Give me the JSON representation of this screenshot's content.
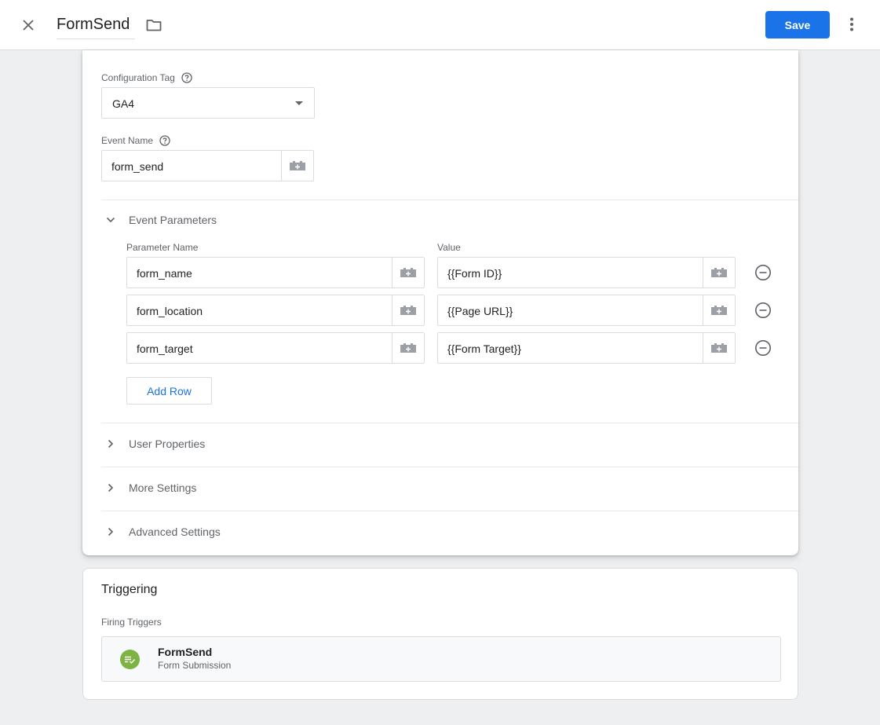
{
  "header": {
    "title": "FormSend",
    "save_label": "Save"
  },
  "config": {
    "config_tag_label": "Configuration Tag",
    "config_tag_value": "GA4",
    "event_name_label": "Event Name",
    "event_name_value": "form_send"
  },
  "event_parameters": {
    "section_label": "Event Parameters",
    "col_name": "Parameter Name",
    "col_value": "Value",
    "rows": [
      {
        "name": "form_name",
        "value": "{{Form ID}}"
      },
      {
        "name": "form_location",
        "value": "{{Page URL}}"
      },
      {
        "name": "form_target",
        "value": "{{Form Target}}"
      }
    ],
    "add_row_label": "Add Row"
  },
  "sections": {
    "user_properties": "User Properties",
    "more_settings": "More Settings",
    "advanced_settings": "Advanced Settings"
  },
  "triggering": {
    "title": "Triggering",
    "firing_label": "Firing Triggers",
    "trigger": {
      "name": "FormSend",
      "type": "Form Submission",
      "icon": "form-submission-icon",
      "icon_color": "#7cb342"
    }
  },
  "colors": {
    "accent": "#1a73e8",
    "background": "#eeeff1"
  }
}
